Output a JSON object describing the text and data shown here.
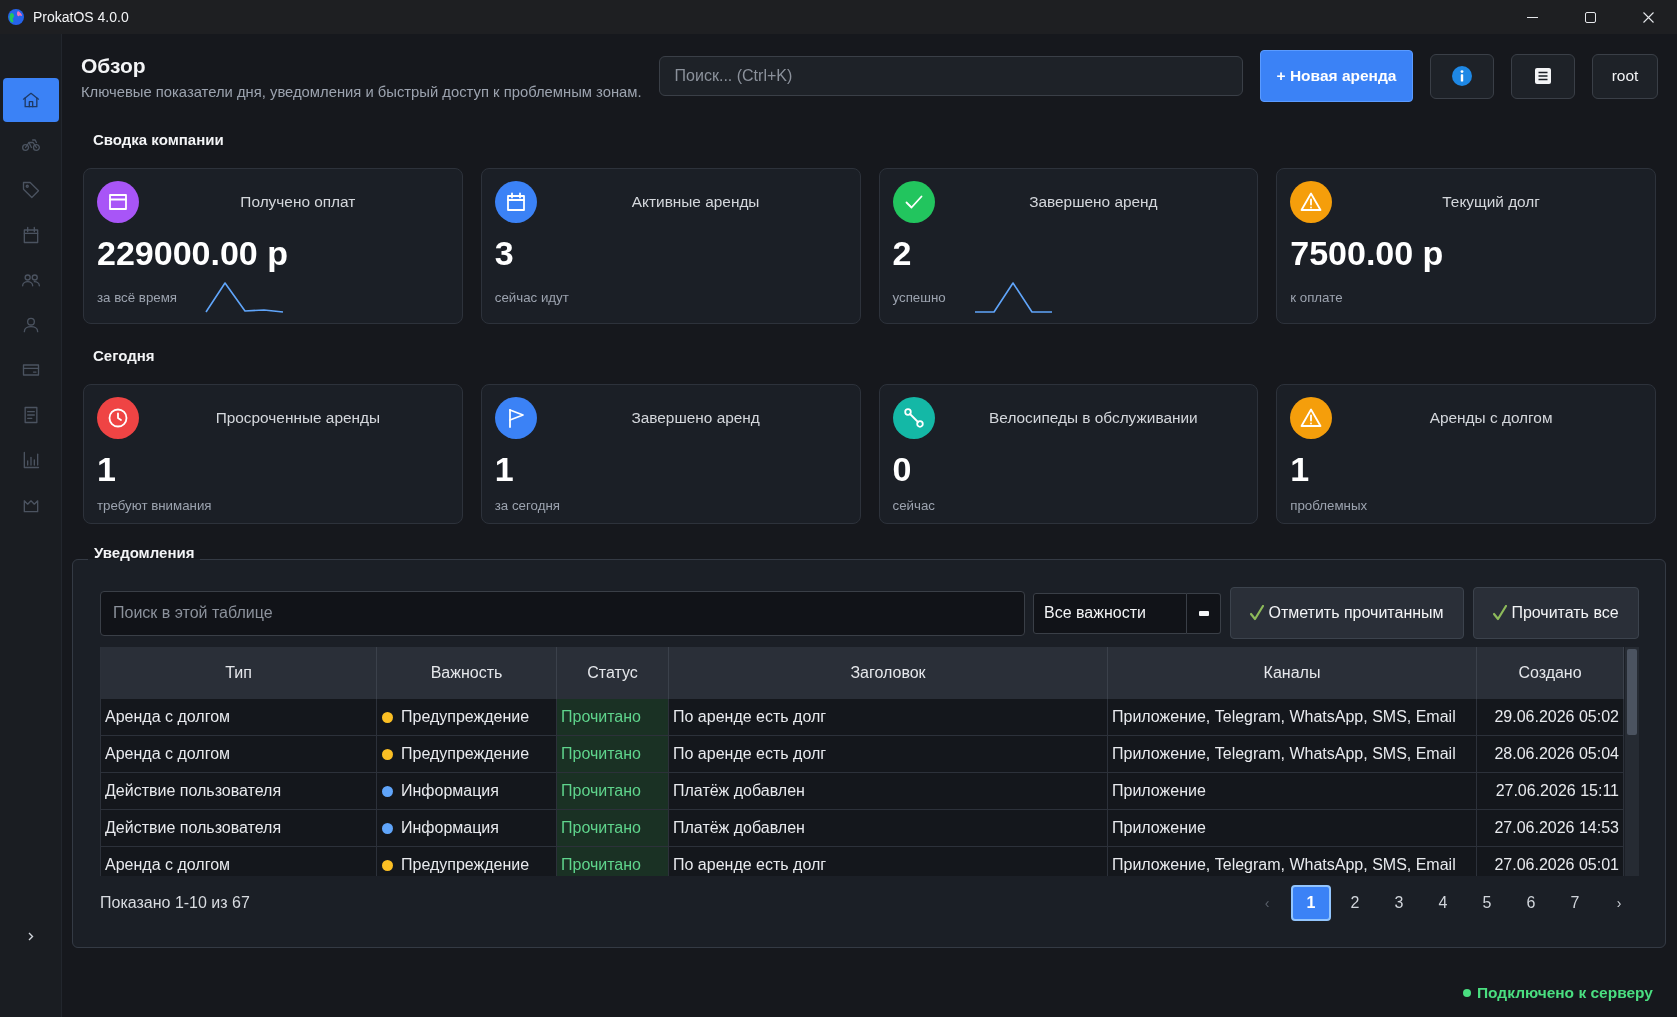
{
  "window": {
    "title": "ProkatOS 4.0.0"
  },
  "sidebar": {
    "items": [
      {
        "selected": true
      },
      {
        "selected": false
      },
      {
        "selected": false
      },
      {
        "selected": false
      },
      {
        "selected": false
      },
      {
        "selected": false
      },
      {
        "selected": false
      },
      {
        "selected": false
      },
      {
        "selected": false
      },
      {
        "selected": false
      }
    ]
  },
  "header": {
    "title": "Обзор",
    "subtitle": "Ключевые показатели дня, уведомления и быстрый доступ к проблемным зонам.",
    "search": {
      "placeholder": "Поиск... (Ctrl+K)"
    },
    "new_rental_button": "+ Новая аренда",
    "user_button": "root"
  },
  "sections": [
    {
      "title": "Сводка компании",
      "cards": [
        {
          "title": "Получено оплат",
          "value": "229000.00 р",
          "caption": "за всё время",
          "color": "#a855f7",
          "sparkline": true
        },
        {
          "title": "Активные аренды",
          "value": "3",
          "caption": "сейчас идут",
          "color": "#3b82f6",
          "sparkline": false
        },
        {
          "title": "Завершено аренд",
          "value": "2",
          "caption": "успешно",
          "color": "#22c55e",
          "sparkline": true
        },
        {
          "title": "Текущий долг",
          "value": "7500.00 р",
          "caption": "к оплате",
          "color": "#f59e0b",
          "sparkline": false
        }
      ]
    },
    {
      "title": "Сегодня",
      "cards": [
        {
          "title": "Просроченные аренды",
          "value": "1",
          "caption": "требуют внимания",
          "color": "#ef4444",
          "sparkline": false
        },
        {
          "title": "Завершено аренд",
          "value": "1",
          "caption": "за сегодня",
          "color": "#3b82f6",
          "sparkline": false
        },
        {
          "title": "Велосипеды в обслуживании",
          "value": "0",
          "caption": "сейчас",
          "color": "#14b8a6",
          "sparkline": false
        },
        {
          "title": "Аренды с долгом",
          "value": "1",
          "caption": "проблемных",
          "color": "#f59e0b",
          "sparkline": false
        }
      ]
    }
  ],
  "notifications": {
    "title": "Уведомления",
    "search": {
      "placeholder": "Поиск в этой таблице"
    },
    "filter": {
      "value": "Все важности"
    },
    "buttons": [
      {
        "label": "Отметить прочитанным"
      },
      {
        "label": "Прочитать все"
      }
    ],
    "table": {
      "columns": [
        "Тип",
        "Важность",
        "Статус",
        "Заголовок",
        "Каналы",
        "Создано"
      ],
      "rows": [
        {
          "type": "Аренда с долгом",
          "importance": {
            "label": "Предупреждение",
            "color": "#fbbf24"
          },
          "status": "Прочитано",
          "read": true,
          "title": "По аренде есть долг",
          "channels": "Приложение, Telegram, WhatsApp, SMS, Email",
          "created": "29.06.2026 05:02"
        },
        {
          "type": "Аренда с долгом",
          "importance": {
            "label": "Предупреждение",
            "color": "#fbbf24"
          },
          "status": "Прочитано",
          "read": true,
          "title": "По аренде есть долг",
          "channels": "Приложение, Telegram, WhatsApp, SMS, Email",
          "created": "28.06.2026 05:04"
        },
        {
          "type": "Действие пользователя",
          "importance": {
            "label": "Информация",
            "color": "#60a5fa"
          },
          "status": "Прочитано",
          "read": true,
          "title": "Платёж добавлен",
          "channels": "Приложение",
          "created": "27.06.2026 15:11"
        },
        {
          "type": "Действие пользователя",
          "importance": {
            "label": "Информация",
            "color": "#60a5fa"
          },
          "status": "Прочитано",
          "read": true,
          "title": "Платёж добавлен",
          "channels": "Приложение",
          "created": "27.06.2026 14:53"
        },
        {
          "type": "Аренда с долгом",
          "importance": {
            "label": "Предупреждение",
            "color": "#fbbf24"
          },
          "status": "Прочитано",
          "read": true,
          "title": "По аренде есть долг",
          "channels": "Приложение, Telegram, WhatsApp, SMS, Email",
          "created": "27.06.2026 05:01"
        }
      ]
    },
    "pagination": {
      "summary": "Показано 1-10 из 67",
      "prev": {
        "label": "‹",
        "disabled": true
      },
      "pages": [
        {
          "label": "1",
          "selected": true
        },
        {
          "label": "2",
          "selected": false
        },
        {
          "label": "3",
          "selected": false
        },
        {
          "label": "4",
          "selected": false
        },
        {
          "label": "5",
          "selected": false
        },
        {
          "label": "6",
          "selected": false
        },
        {
          "label": "7",
          "selected": false
        }
      ],
      "next": {
        "label": "›",
        "disabled": false
      }
    }
  },
  "status_bar": {
    "text": "Подключено к серверу",
    "connected": true
  }
}
